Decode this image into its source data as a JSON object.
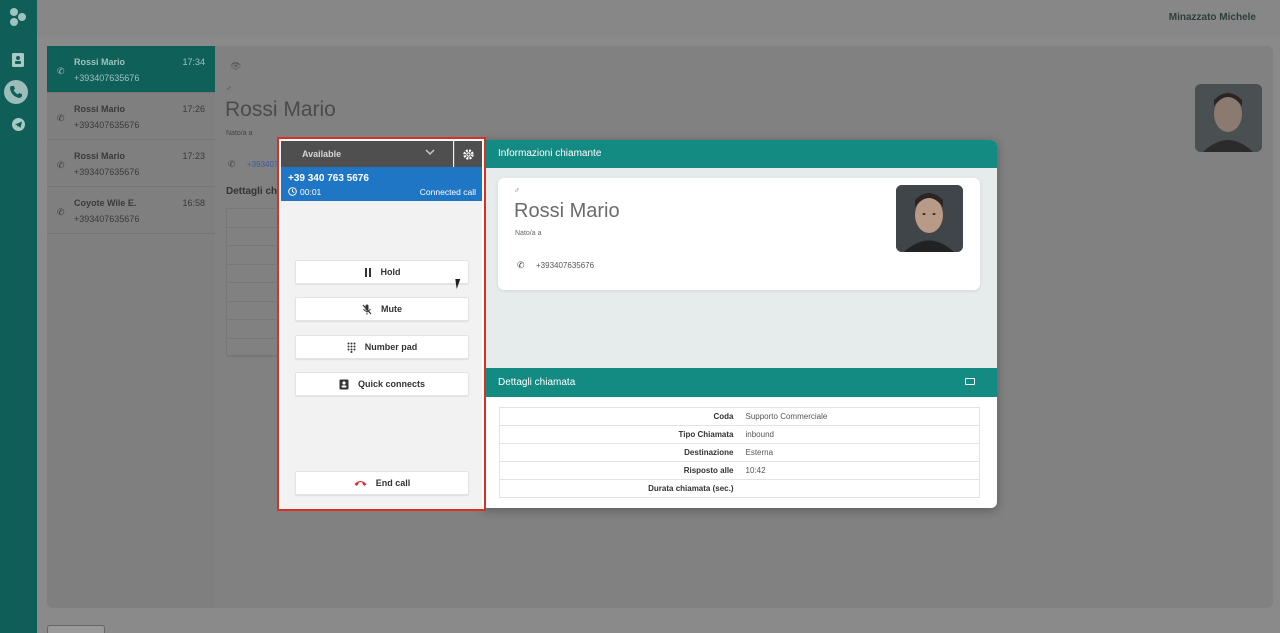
{
  "header": {
    "user_name": "Minazzato Michele"
  },
  "sidebar": {
    "icons": [
      "logo-icon",
      "contacts-icon",
      "phone-icon",
      "telegram-icon"
    ]
  },
  "call_list": [
    {
      "name": "Rossi Mario",
      "number": "+393407635676",
      "time": "17:34",
      "active": true
    },
    {
      "name": "Rossi Mario",
      "number": "+393407635676",
      "time": "17:26",
      "active": false
    },
    {
      "name": "Rossi Mario",
      "number": "+393407635676",
      "time": "17:23",
      "active": false
    },
    {
      "name": "Coyote Wile E.",
      "number": "+393407635676",
      "time": "16:58",
      "active": false
    }
  ],
  "background_detail": {
    "gender": "♂",
    "name": "Rossi Mario",
    "nato": "Nato/a a",
    "phone": "+39340763",
    "section_title": "Dettagli chia"
  },
  "ccp": {
    "status": "Available",
    "call_number": "+39 340 763 5676",
    "timer": "00:01",
    "call_status": "Connected call",
    "buttons": {
      "hold": "Hold",
      "mute": "Mute",
      "number_pad": "Number pad",
      "quick_connects": "Quick connects",
      "end_call": "End call"
    }
  },
  "caller_info": {
    "header": "Informazioni chiamante",
    "gender": "♂",
    "name": "Rossi Mario",
    "nato": "Nato/a a",
    "phone": "+393407635676"
  },
  "call_details": {
    "header": "Dettagli chiamata",
    "rows": [
      {
        "key": "Coda",
        "value": "Supporto Commerciale"
      },
      {
        "key": "Tipo Chiamata",
        "value": "inbound"
      },
      {
        "key": "Destinazione",
        "value": "Esterna"
      },
      {
        "key": "Risposto alle",
        "value": "10:42"
      },
      {
        "key": "Durata chiamata (sec.)",
        "value": ""
      }
    ]
  },
  "colors": {
    "sidebar": "#0f5e57",
    "teal_header": "#138a82",
    "ccp_call_bar": "#1e76c4",
    "highlight_border": "#d93025",
    "end_call_icon": "#d0312d"
  }
}
